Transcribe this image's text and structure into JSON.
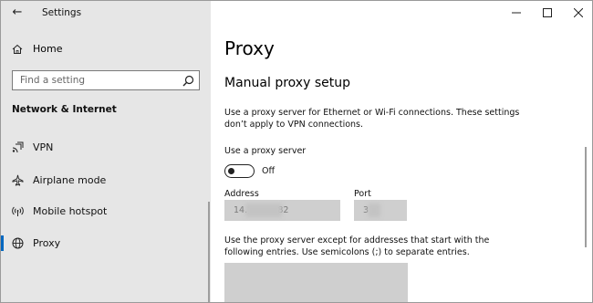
{
  "window": {
    "app_title": "Settings",
    "back_icon": "←"
  },
  "sidebar": {
    "home_label": "Home",
    "search_placeholder": "Find a setting",
    "section_title": "Network & Internet",
    "items": [
      {
        "label": "VPN",
        "icon": "vpn-icon",
        "selected": false
      },
      {
        "label": "Airplane mode",
        "icon": "airplane-icon",
        "selected": false
      },
      {
        "label": "Mobile hotspot",
        "icon": "hotspot-icon",
        "selected": false
      },
      {
        "label": "Proxy",
        "icon": "globe-icon",
        "selected": true
      }
    ]
  },
  "main": {
    "title": "Proxy",
    "section_title": "Manual proxy setup",
    "description": "Use a proxy server for Ethernet or Wi-Fi connections. These settings don’t apply to VPN connections.",
    "use_proxy_label": "Use a proxy server",
    "toggle_state": "Off",
    "toggle_on": false,
    "address_label": "Address",
    "address_value": "14.          .82",
    "port_label": "Port",
    "port_value": "3",
    "exceptions_description": "Use the proxy server except for addresses that start with the following entries. Use semicolons (;) to separate entries.",
    "exceptions_value": ""
  },
  "colors": {
    "sidebar_bg": "#e6e6e6",
    "accent": "#0067c0",
    "field_bg": "#cfcfcf"
  }
}
